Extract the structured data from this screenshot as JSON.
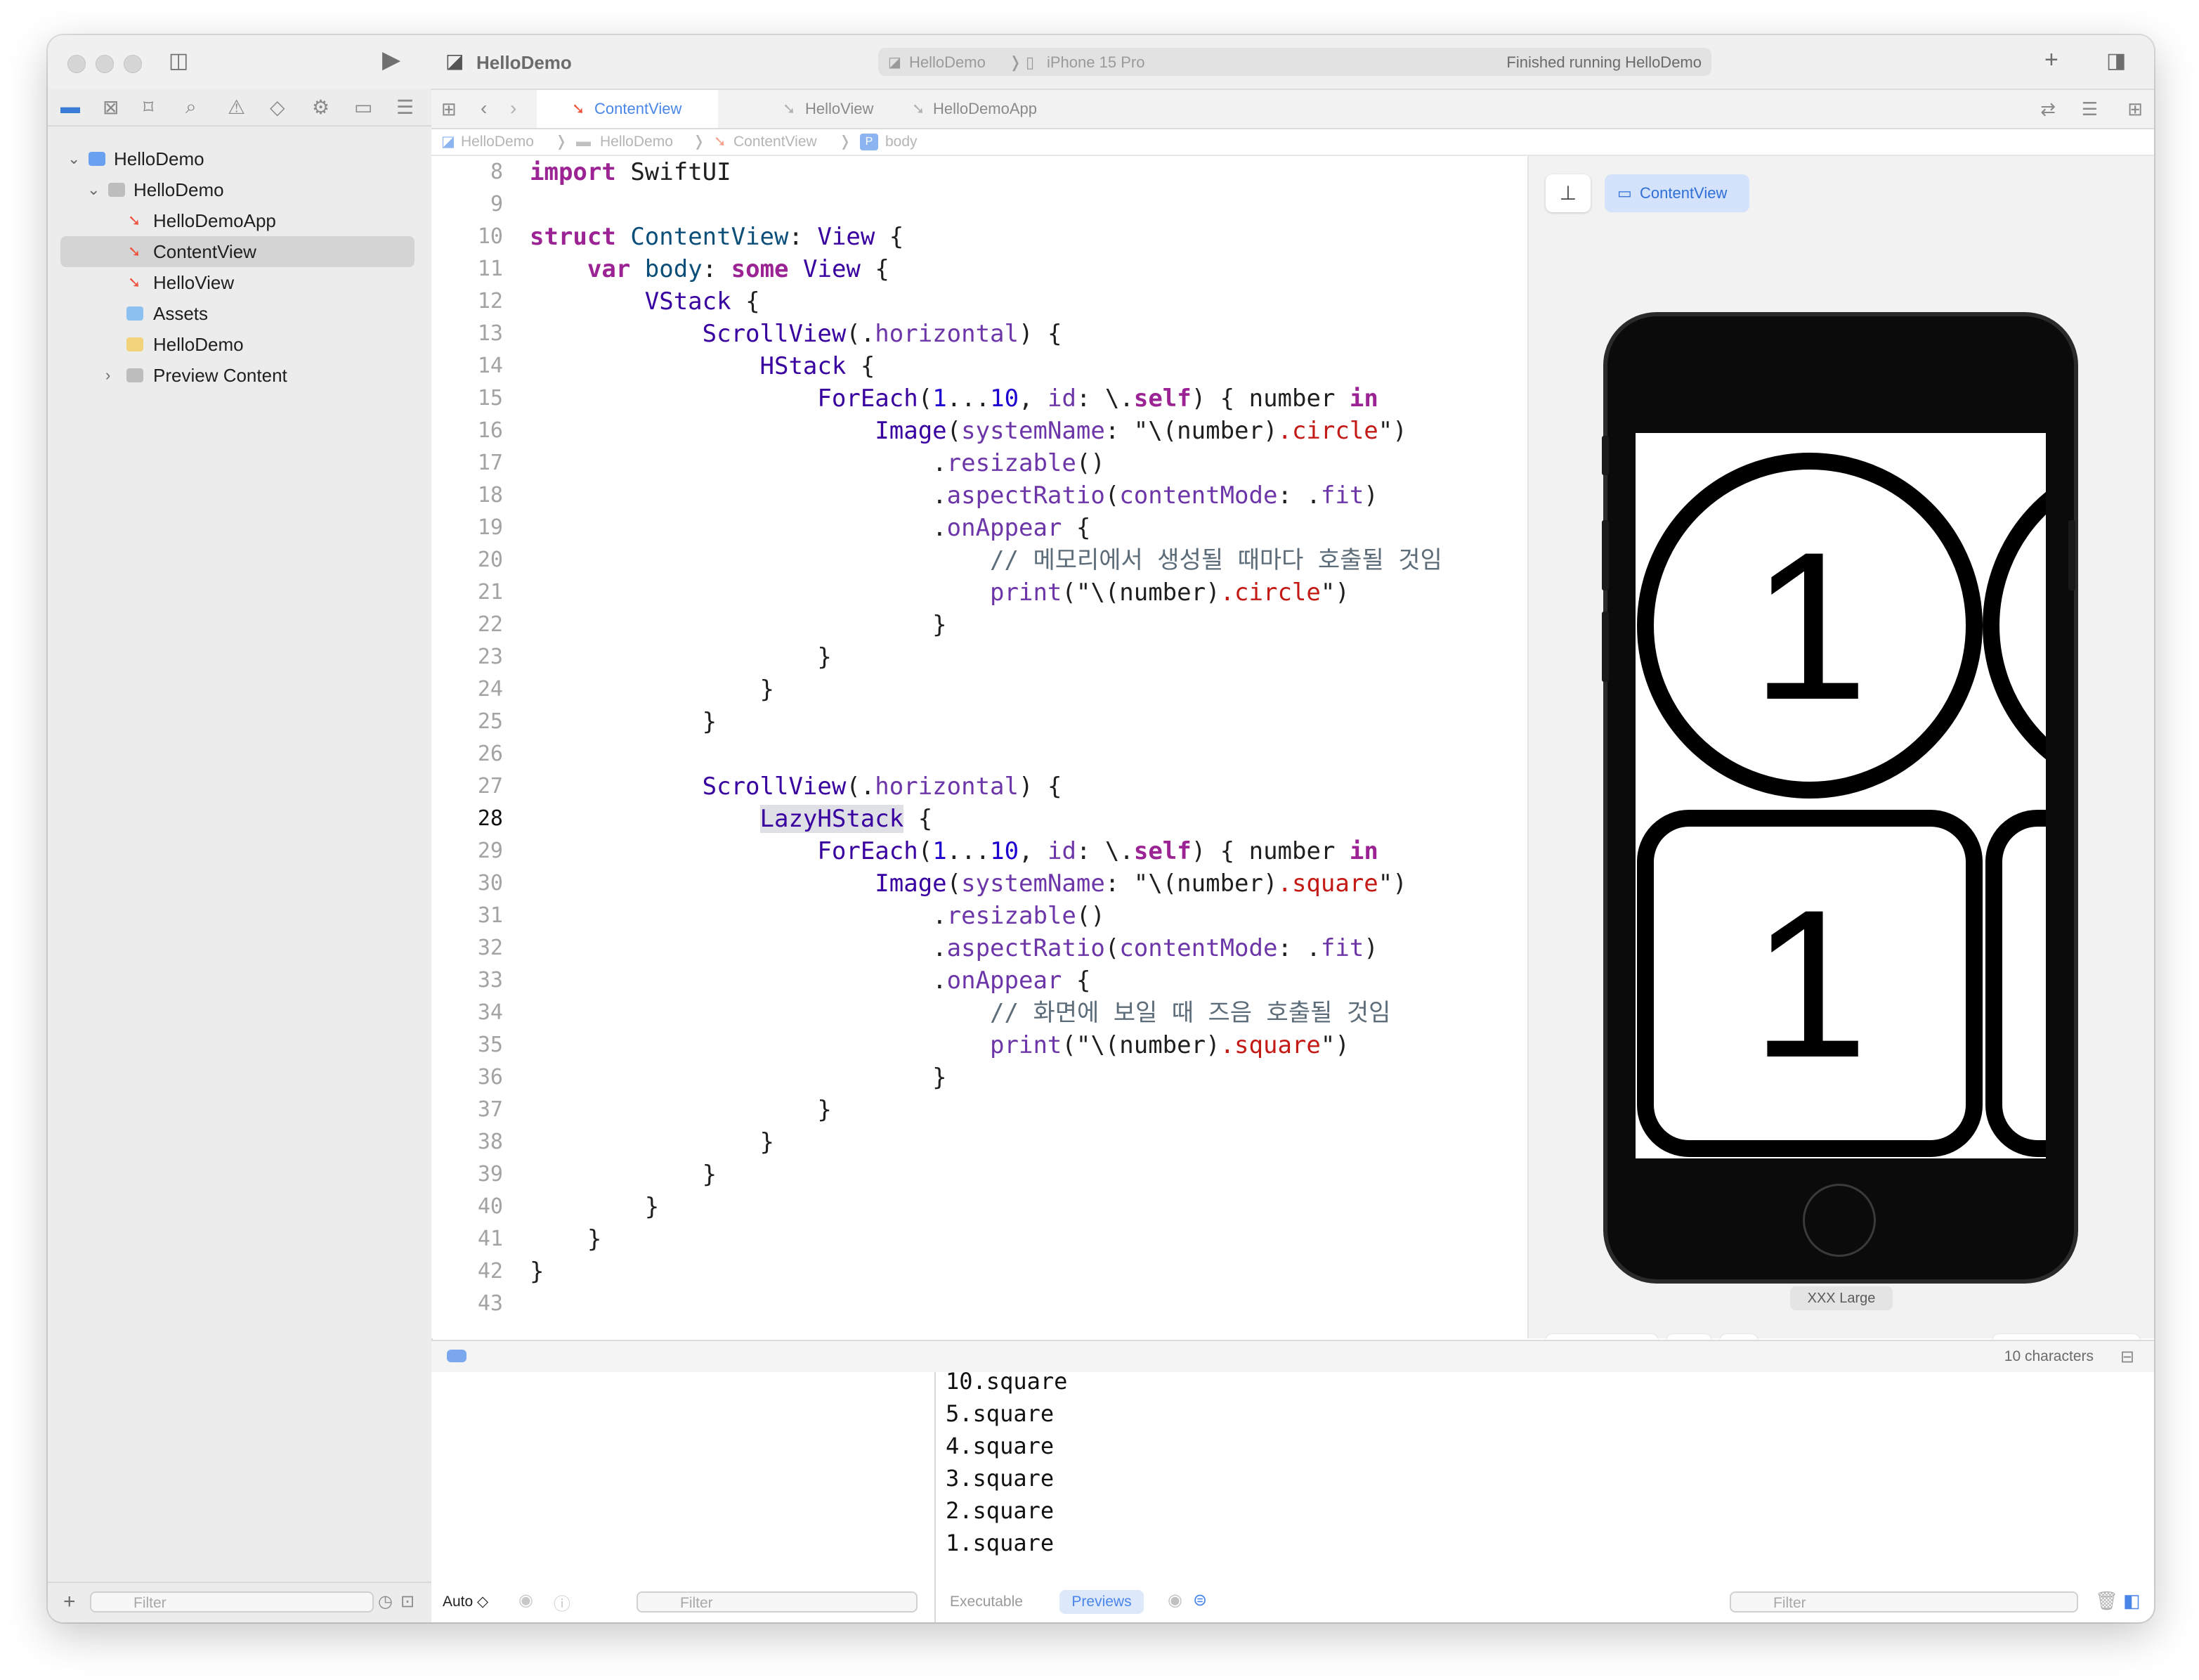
{
  "app": {
    "title": "HelloDemo"
  },
  "activity": {
    "scheme": "HelloDemo",
    "device": "iPhone 15 Pro",
    "status": "Finished running HelloDemo"
  },
  "navigator": {
    "items": [
      {
        "label": "HelloDemo",
        "kind": "project"
      },
      {
        "label": "HelloDemo",
        "kind": "folder"
      },
      {
        "label": "HelloDemoApp",
        "kind": "swift"
      },
      {
        "label": "ContentView",
        "kind": "swift"
      },
      {
        "label": "HelloView",
        "kind": "swift"
      },
      {
        "label": "Assets",
        "kind": "assets"
      },
      {
        "label": "HelloDemo",
        "kind": "entitlements"
      },
      {
        "label": "Preview Content",
        "kind": "folder"
      }
    ],
    "filter_placeholder": "Filter"
  },
  "editor": {
    "tabs": [
      "ContentView",
      "HelloView",
      "HelloDemoApp"
    ],
    "jump_bar": [
      "HelloDemo",
      "HelloDemo",
      "ContentView",
      "body"
    ],
    "current_line": "28",
    "lines": [
      {
        "n": "8",
        "text": "import SwiftUI"
      },
      {
        "n": "9",
        "text": ""
      },
      {
        "n": "10",
        "text": "struct ContentView: View {"
      },
      {
        "n": "11",
        "text": "    var body: some View {"
      },
      {
        "n": "12",
        "text": "        VStack {"
      },
      {
        "n": "13",
        "text": "            ScrollView(.horizontal) {"
      },
      {
        "n": "14",
        "text": "                HStack {"
      },
      {
        "n": "15",
        "text": "                    ForEach(1...10, id: \\.self) { number in"
      },
      {
        "n": "16",
        "text": "                        Image(systemName: \"\\(number).circle\")"
      },
      {
        "n": "17",
        "text": "                            .resizable()"
      },
      {
        "n": "18",
        "text": "                            .aspectRatio(contentMode: .fit)"
      },
      {
        "n": "19",
        "text": "                            .onAppear {"
      },
      {
        "n": "20",
        "text": "                                // 메모리에서 생성될 때마다 호출될 것임"
      },
      {
        "n": "21",
        "text": "                                print(\"\\(number).circle\")"
      },
      {
        "n": "22",
        "text": "                            }"
      },
      {
        "n": "23",
        "text": "                    }"
      },
      {
        "n": "24",
        "text": "                }"
      },
      {
        "n": "25",
        "text": "            }"
      },
      {
        "n": "26",
        "text": ""
      },
      {
        "n": "27",
        "text": "            ScrollView(.horizontal) {"
      },
      {
        "n": "28",
        "text": "                LazyHStack {"
      },
      {
        "n": "29",
        "text": "                    ForEach(1...10, id: \\.self) { number in"
      },
      {
        "n": "30",
        "text": "                        Image(systemName: \"\\(number).square\")"
      },
      {
        "n": "31",
        "text": "                            .resizable()"
      },
      {
        "n": "32",
        "text": "                            .aspectRatio(contentMode: .fit)"
      },
      {
        "n": "33",
        "text": "                            .onAppear {"
      },
      {
        "n": "34",
        "text": "                                // 화면에 보일 때 즈음 호출될 것임"
      },
      {
        "n": "35",
        "text": "                                print(\"\\(number).square\")"
      },
      {
        "n": "36",
        "text": "                            }"
      },
      {
        "n": "37",
        "text": "                    }"
      },
      {
        "n": "38",
        "text": "                }"
      },
      {
        "n": "39",
        "text": "            }"
      },
      {
        "n": "40",
        "text": "        }"
      },
      {
        "n": "41",
        "text": "    }"
      },
      {
        "n": "42",
        "text": "}"
      },
      {
        "n": "43",
        "text": ""
      }
    ]
  },
  "canvas": {
    "pinned_view": "ContentView",
    "device_size": "XXX Large",
    "preview_numbers": [
      "1",
      "1"
    ]
  },
  "debug": {
    "char_count": "10 characters",
    "auto_label": "Auto ◇",
    "filter_placeholder": "Filter",
    "tabs": [
      "Executable",
      "Previews"
    ],
    "console_lines": [
      "10.square",
      "5.square",
      "4.square",
      "3.square",
      "2.square",
      "1.square"
    ]
  },
  "colors": {
    "accent": "#4a86e8",
    "keyword": "#9b2393",
    "type": "#3900a0",
    "string": "#c41a16",
    "selection": "#d4d4d4"
  }
}
